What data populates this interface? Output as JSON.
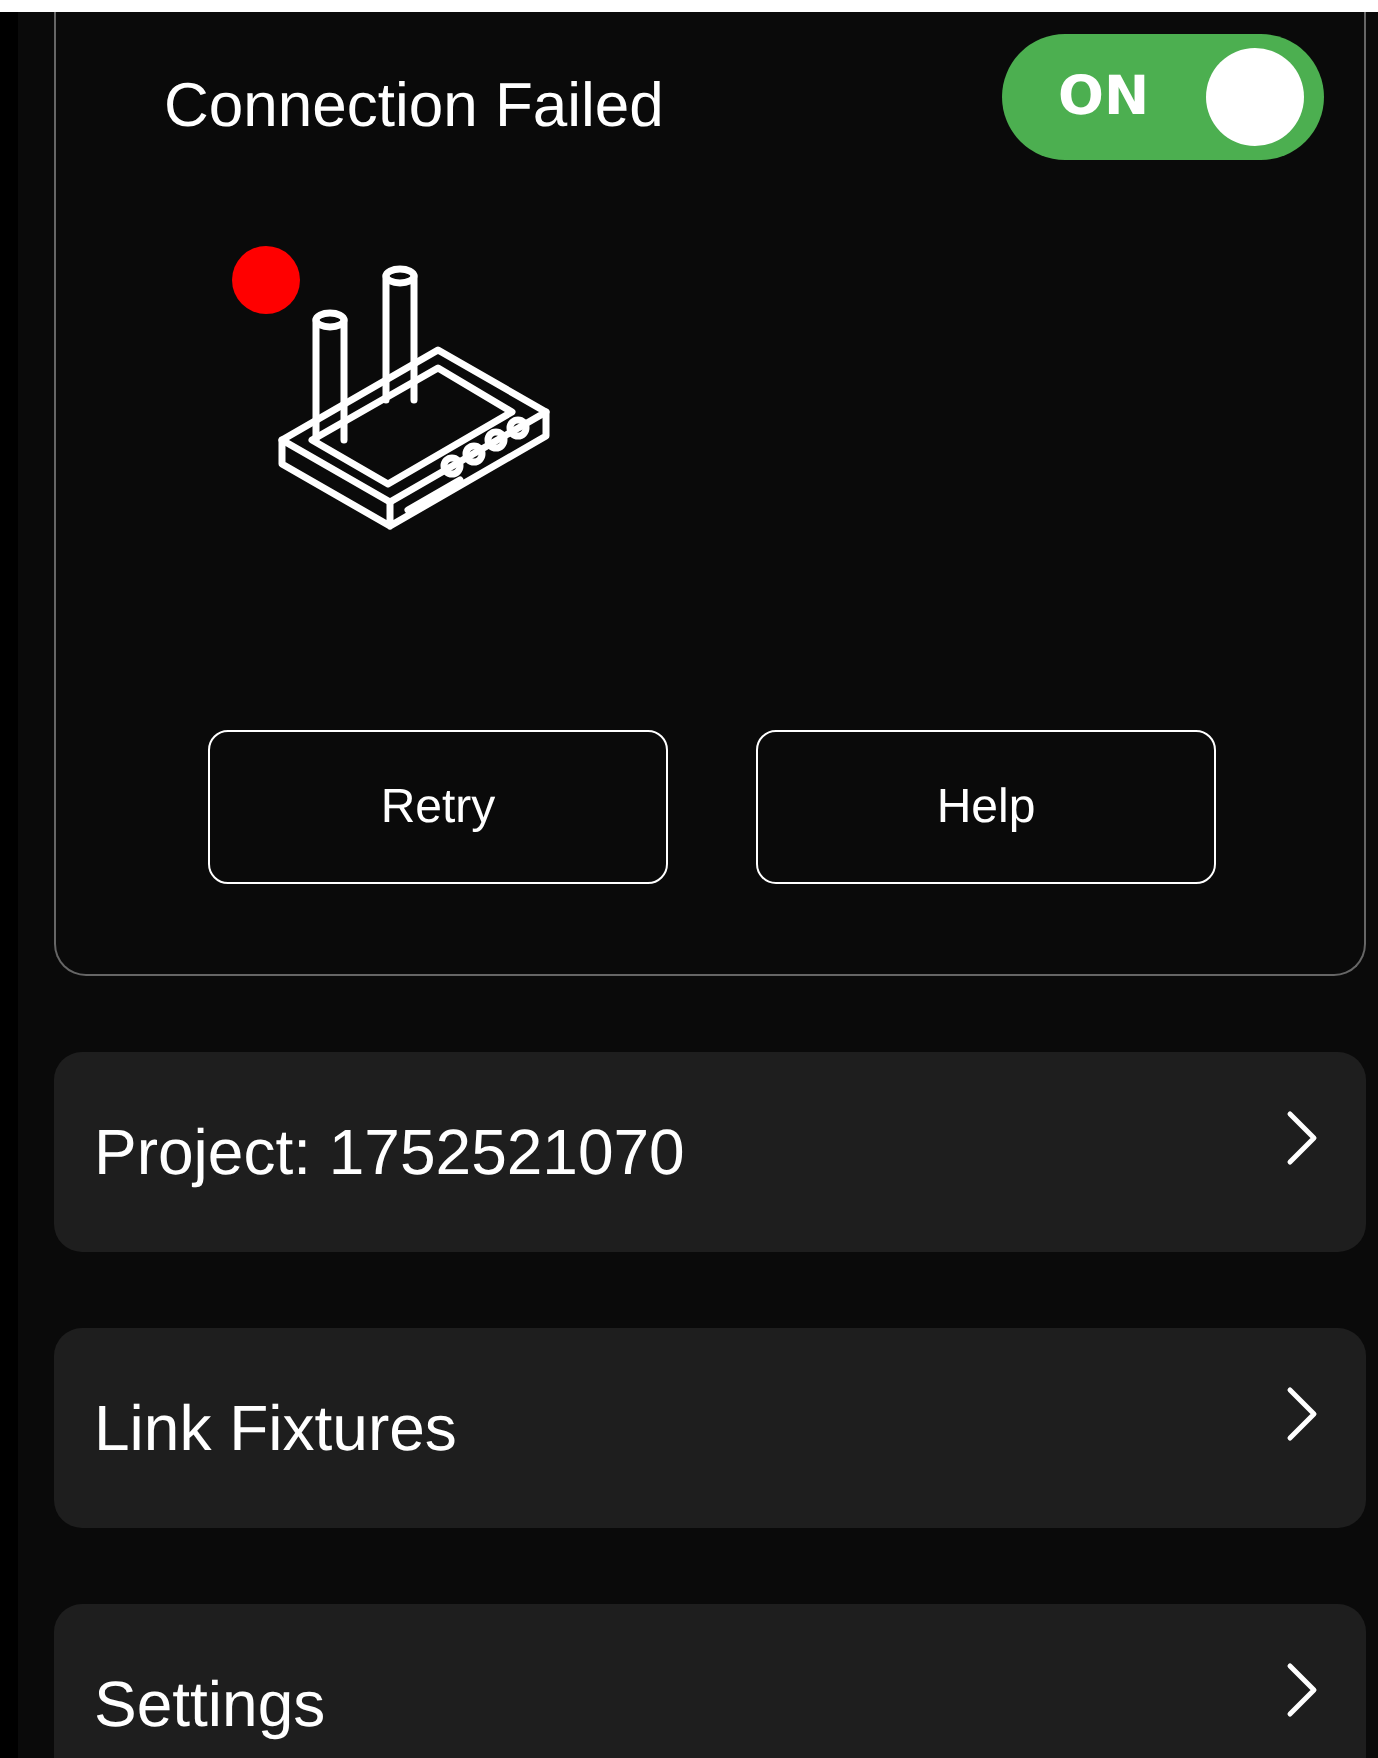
{
  "connection": {
    "title": "Connection Failed",
    "status": {
      "color": "#ff0000"
    },
    "toggle": {
      "label": "ON",
      "on": true
    },
    "buttons": [
      "Retry",
      "Help"
    ]
  },
  "menu": [
    {
      "label": "Project: 1752521070"
    },
    {
      "label": "Link Fixtures"
    },
    {
      "label": "Settings"
    }
  ]
}
